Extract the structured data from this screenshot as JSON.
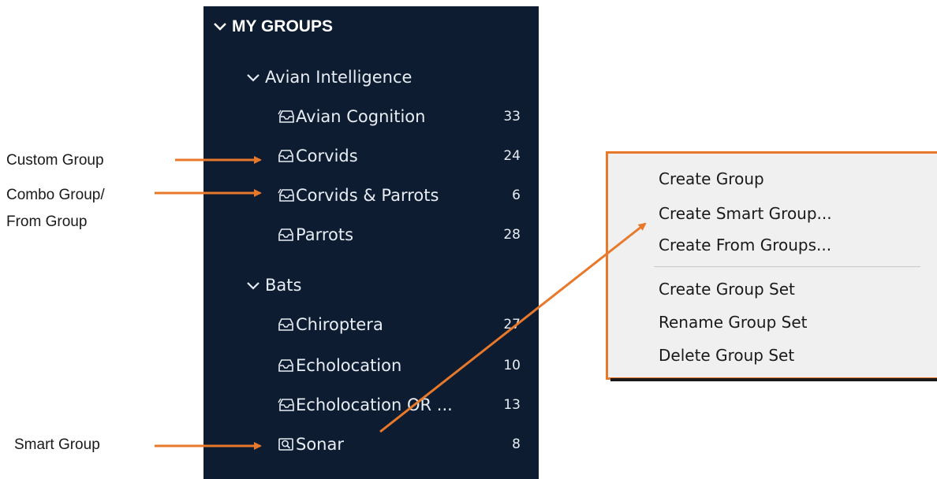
{
  "sidebar": {
    "header": "MY GROUPS",
    "sets": [
      {
        "label": "Avian Intelligence",
        "groups": [
          {
            "label": "Avian Cognition",
            "count": "33",
            "icon": "combo-group-icon"
          },
          {
            "label": "Corvids",
            "count": "24",
            "icon": "custom-group-icon"
          },
          {
            "label": "Corvids & Parrots",
            "count": "6",
            "icon": "combo-group-icon"
          },
          {
            "label": "Parrots",
            "count": "28",
            "icon": "custom-group-icon"
          }
        ]
      },
      {
        "label": "Bats",
        "groups": [
          {
            "label": "Chiroptera",
            "count": "27",
            "icon": "custom-group-icon"
          },
          {
            "label": "Echolocation",
            "count": "10",
            "icon": "custom-group-icon"
          },
          {
            "label": "Echolocation OR ...",
            "count": "13",
            "icon": "combo-group-icon"
          },
          {
            "label": "Sonar",
            "count": "8",
            "icon": "smart-group-icon"
          }
        ]
      }
    ]
  },
  "annotations": {
    "custom_group": "Custom Group",
    "combo_line1": "Combo Group/",
    "combo_line2": "From Group",
    "smart_group": "Smart Group"
  },
  "context_menu": {
    "items": [
      "Create Group",
      "Create Smart Group...",
      "Create From Groups...",
      "Create Group Set",
      "Rename Group Set",
      "Delete Group Set"
    ]
  },
  "colors": {
    "panel_bg": "#0d1c31",
    "accent_orange": "#e8782a",
    "menu_bg": "#f0f0f0"
  }
}
